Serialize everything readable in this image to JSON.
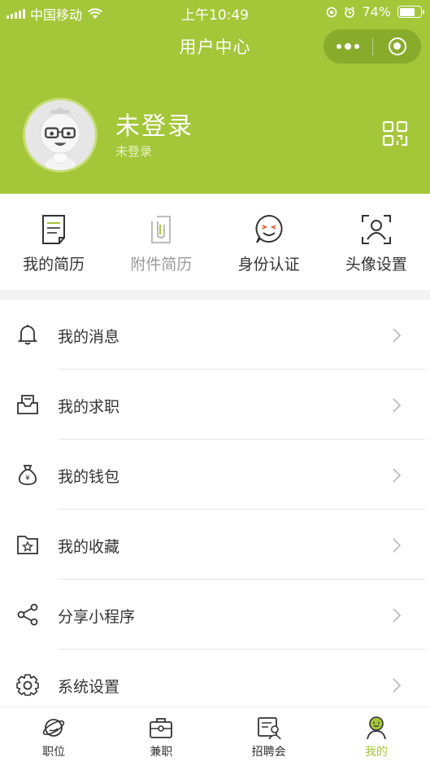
{
  "status_bar": {
    "carrier": "中国移动",
    "time": "上午10:49",
    "battery": "74%",
    "battery_level": 0.74
  },
  "nav": {
    "title": "用户中心",
    "more_icon": "more-dots-icon",
    "close_icon": "mini-program-close-icon"
  },
  "profile": {
    "name": "未登录",
    "subtitle": "未登录",
    "qr_icon": "qr-code-icon"
  },
  "quick_actions": [
    {
      "label": "我的简历",
      "icon": "resume-icon",
      "enabled": true
    },
    {
      "label": "附件简历",
      "icon": "attachment-resume-icon",
      "enabled": false
    },
    {
      "label": "身份认证",
      "icon": "identity-verify-icon",
      "enabled": true
    },
    {
      "label": "头像设置",
      "icon": "avatar-setting-icon",
      "enabled": true
    }
  ],
  "menu": [
    {
      "label": "我的消息",
      "icon": "bell-icon"
    },
    {
      "label": "我的求职",
      "icon": "job-inbox-icon"
    },
    {
      "label": "我的钱包",
      "icon": "money-bag-icon"
    },
    {
      "label": "我的收藏",
      "icon": "favorite-folder-icon"
    },
    {
      "label": "分享小程序",
      "icon": "share-icon"
    },
    {
      "label": "系统设置",
      "icon": "gear-icon"
    }
  ],
  "tabbar": [
    {
      "label": "职位",
      "icon": "planet-icon",
      "active": false
    },
    {
      "label": "兼职",
      "icon": "briefcase-icon",
      "active": false
    },
    {
      "label": "招聘会",
      "icon": "job-fair-icon",
      "active": false
    },
    {
      "label": "我的",
      "icon": "profile-icon",
      "active": true
    }
  ],
  "colors": {
    "brand": "#a4c639",
    "text": "#333333",
    "disabled_text": "#999999",
    "divider": "#e5e5e5"
  }
}
